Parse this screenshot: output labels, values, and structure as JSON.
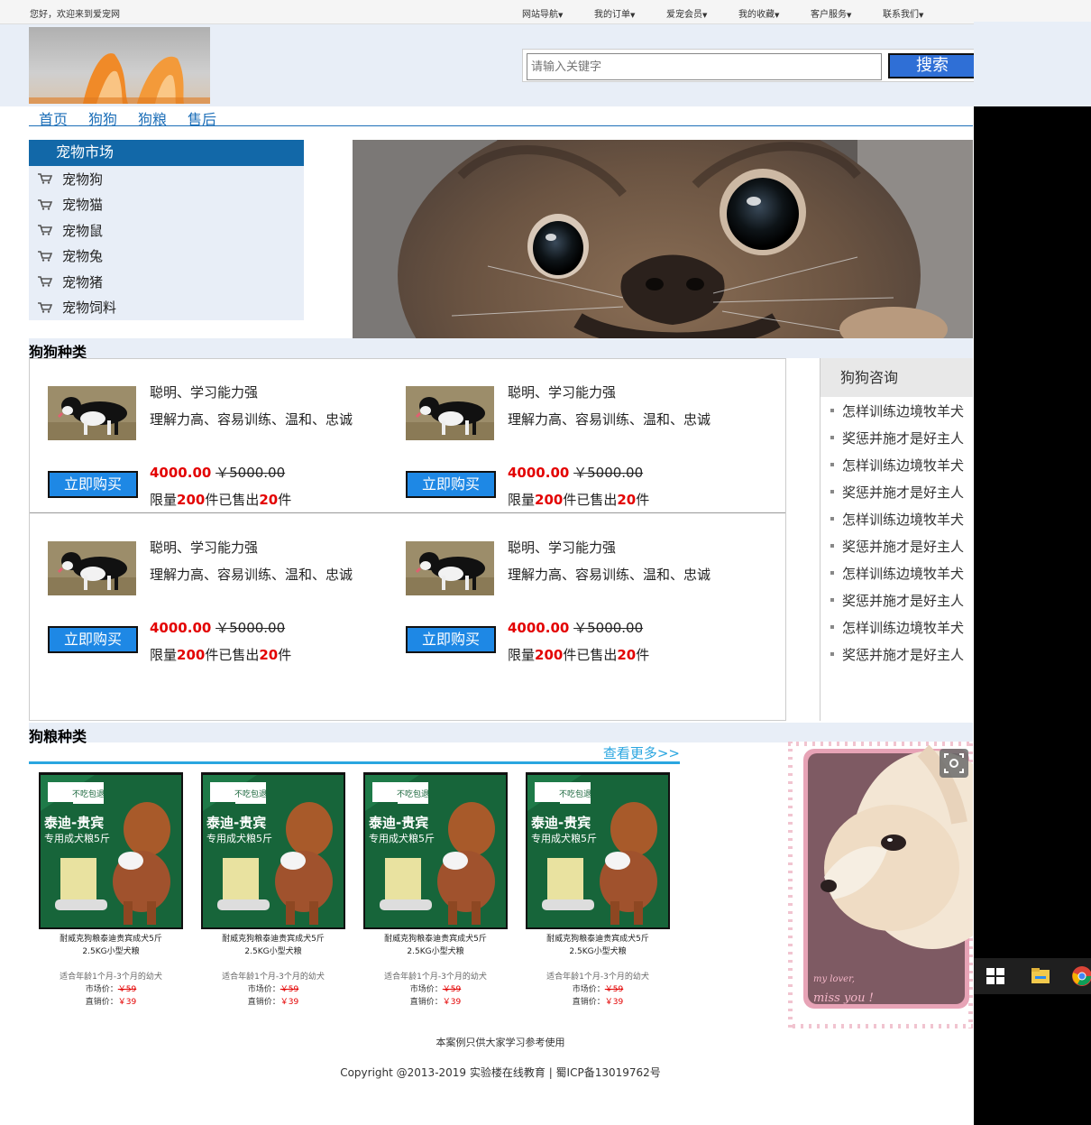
{
  "topbar": {
    "welcome": "您好，欢迎来到爱宠网",
    "nav": [
      "网站导航",
      "我的订单",
      "爱宠会员",
      "我的收藏",
      "客户服务",
      "联系我们"
    ]
  },
  "search": {
    "placeholder": "请输入关键字",
    "button": "搜索"
  },
  "mainnav": [
    "首页",
    "狗狗",
    "狗粮",
    "售后"
  ],
  "sidebar": {
    "title": "宠物市场",
    "items": [
      "宠物狗",
      "宠物猫",
      "宠物鼠",
      "宠物兔",
      "宠物猪",
      "宠物饲料"
    ]
  },
  "dogs": {
    "title": "狗狗种类",
    "cards": [
      {
        "line1": "聪明、学习能力强",
        "line2": "理解力高、容易训练、温和、忠诚",
        "button": "立即购买",
        "price": "4000.00",
        "old_price": "￥5000.00",
        "limit_prefix": "限量",
        "limit": "200",
        "sold_mid": "件已售出",
        "sold": "20",
        "unit": "件"
      },
      {
        "line1": "聪明、学习能力强",
        "line2": "理解力高、容易训练、温和、忠诚",
        "button": "立即购买",
        "price": "4000.00",
        "old_price": "￥5000.00",
        "limit_prefix": "限量",
        "limit": "200",
        "sold_mid": "件已售出",
        "sold": "20",
        "unit": "件"
      },
      {
        "line1": "聪明、学习能力强",
        "line2": "理解力高、容易训练、温和、忠诚",
        "button": "立即购买",
        "price": "4000.00",
        "old_price": "￥5000.00",
        "limit_prefix": "限量",
        "limit": "200",
        "sold_mid": "件已售出",
        "sold": "20",
        "unit": "件"
      },
      {
        "line1": "聪明、学习能力强",
        "line2": "理解力高、容易训练、温和、忠诚",
        "button": "立即购买",
        "price": "4000.00",
        "old_price": "￥5000.00",
        "limit_prefix": "限量",
        "limit": "200",
        "sold_mid": "件已售出",
        "sold": "20",
        "unit": "件"
      }
    ]
  },
  "consult": {
    "title": "狗狗咨询",
    "items": [
      "怎样训练边境牧羊犬",
      "奖惩并施才是好主人",
      "怎样训练边境牧羊犬",
      "奖惩并施才是好主人",
      "怎样训练边境牧羊犬",
      "奖惩并施才是好主人",
      "怎样训练边境牧羊犬",
      "奖惩并施才是好主人",
      "怎样训练边境牧羊犬",
      "奖惩并施才是好主人"
    ]
  },
  "food": {
    "title": "狗粮种类",
    "more": "查看更多>>",
    "cards": [
      {
        "name1": "耐威克狗粮泰迪贵宾成犬5斤",
        "name2": "2.5KG小型犬粮",
        "suit": "适合年龄1个月-3个月的幼犬",
        "market_label": "市场价：",
        "market_price": "￥59",
        "direct_label": "直销价：",
        "direct_price": "￥39"
      },
      {
        "name1": "耐威克狗粮泰迪贵宾成犬5斤",
        "name2": "2.5KG小型犬粮",
        "suit": "适合年龄1个月-3个月的幼犬",
        "market_label": "市场价：",
        "market_price": "￥59",
        "direct_label": "直销价：",
        "direct_price": "￥39"
      },
      {
        "name1": "耐威克狗粮泰迪贵宾成犬5斤",
        "name2": "2.5KG小型犬粮",
        "suit": "适合年龄1个月-3个月的幼犬",
        "market_label": "市场价：",
        "market_price": "￥59",
        "direct_label": "直销价：",
        "direct_price": "￥39"
      },
      {
        "name1": "耐威克狗粮泰迪贵宾成犬5斤",
        "name2": "2.5KG小型犬粮",
        "suit": "适合年龄1个月-3个月的幼犬",
        "market_label": "市场价：",
        "market_price": "￥59",
        "direct_label": "直销价：",
        "direct_price": "￥39"
      }
    ],
    "package_text": {
      "badge": "不吃包退",
      "title": "泰迪-贵宾",
      "subtitle": "专用成犬粮5斤"
    }
  },
  "side_photo_text": {
    "line1": "my lover,",
    "line2": "miss you !"
  },
  "footer": {
    "line1": "本案例只供大家学习参考使用",
    "line2": "Copyright @2013-2019 实验楼在线教育 | 蜀ICP备13019762号"
  },
  "colors": {
    "accent_blue": "#1268a8",
    "button_blue": "#1e88e5",
    "price_red": "#e30000",
    "link_cyan": "#2aa6e0"
  },
  "taskbar_icons": [
    "windows-start-icon",
    "file-explorer-icon",
    "chrome-icon"
  ]
}
